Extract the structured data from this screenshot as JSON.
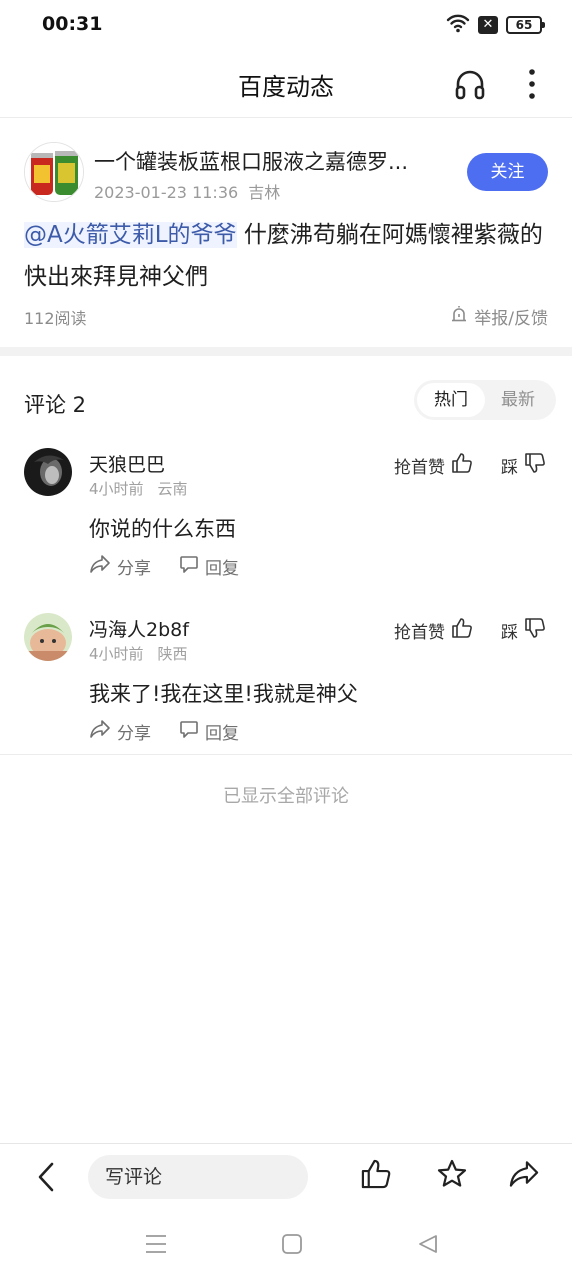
{
  "status_bar": {
    "time": "00:31",
    "sim_badge": "✕",
    "battery": "65"
  },
  "header": {
    "title": "百度动态",
    "headphone_icon": "headphone-icon",
    "more_icon": "more-vertical-icon"
  },
  "post": {
    "author": "一个罐装板蓝根口服液之嘉德罗...",
    "date": "2023-01-23 11:36",
    "location": "吉林",
    "follow_label": "关注",
    "mention": "@A火箭艾莉L的爷爷",
    "body": " 什麼沸苟躺在阿媽懷裡紫薇的快出來拜見神父們",
    "reads": "112阅读",
    "report_label": "举报/反馈"
  },
  "comments_header": {
    "title": "评论  2",
    "sort_hot": "热门",
    "sort_new": "最新"
  },
  "comments": [
    {
      "name": "天狼巴巴",
      "time": "4小时前",
      "location": "云南",
      "text": "你说的什么东西",
      "like_label": "抢首赞",
      "dislike_label": "踩",
      "share_label": "分享",
      "reply_label": "回复"
    },
    {
      "name": "冯海人2b8f",
      "time": "4小时前",
      "location": "陕西",
      "text": "我来了!我在这里!我就是神父",
      "like_label": "抢首赞",
      "dislike_label": "踩",
      "share_label": "分享",
      "reply_label": "回复"
    }
  ],
  "footer_note": "已显示全部评论",
  "bottom_bar": {
    "input_placeholder": "写评论"
  },
  "colors": {
    "accent": "#4e6ef2",
    "mention": "#3d5ba9"
  }
}
